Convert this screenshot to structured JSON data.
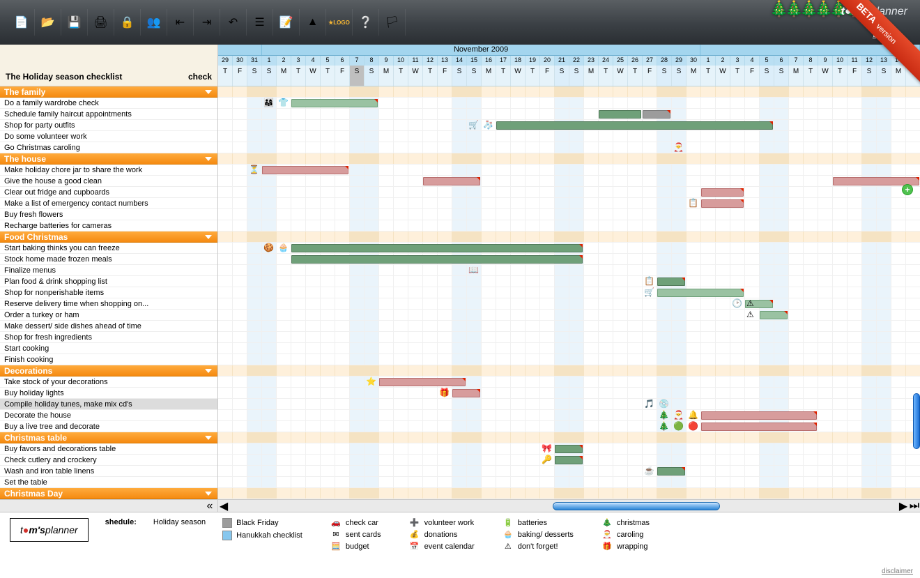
{
  "brand": "tom'splanner",
  "ribbon": {
    "main": "BETA",
    "sub": "version"
  },
  "logout": "Log out",
  "toolbar_icons": [
    {
      "name": "new-icon",
      "glyph": "📄"
    },
    {
      "name": "open-icon",
      "glyph": "📂"
    },
    {
      "name": "save-icon",
      "glyph": "💾"
    },
    {
      "name": "print-icon",
      "glyph": "🖨"
    },
    {
      "name": "lock-icon",
      "glyph": "🔒"
    },
    {
      "name": "share-icon",
      "glyph": "👥"
    },
    {
      "name": "import-icon",
      "glyph": "⇤"
    },
    {
      "name": "export-icon",
      "glyph": "⇥"
    },
    {
      "name": "undo-icon",
      "glyph": "↶"
    },
    {
      "name": "list-icon",
      "glyph": "☰"
    },
    {
      "name": "edit-icon",
      "glyph": "📝"
    },
    {
      "name": "milestone-icon",
      "glyph": "▲"
    },
    {
      "name": "logo-icon",
      "glyph": "★LOGO"
    },
    {
      "name": "help-icon",
      "glyph": "❔"
    },
    {
      "name": "flag-icon",
      "glyph": "🏳"
    }
  ],
  "left_header": {
    "title": "The Holiday season checklist",
    "col2": "check"
  },
  "timeline": {
    "month_title": "November 2009",
    "start_daynum": 29,
    "days": [
      {
        "n": 29,
        "w": "T",
        "we": false
      },
      {
        "n": 30,
        "w": "F",
        "we": false
      },
      {
        "n": 31,
        "w": "S",
        "we": true
      },
      {
        "n": 1,
        "w": "S",
        "we": true
      },
      {
        "n": 2,
        "w": "M",
        "we": false
      },
      {
        "n": 3,
        "w": "T",
        "we": false
      },
      {
        "n": 4,
        "w": "W",
        "we": false
      },
      {
        "n": 5,
        "w": "T",
        "we": false
      },
      {
        "n": 6,
        "w": "F",
        "we": false
      },
      {
        "n": 7,
        "w": "S",
        "we": true,
        "today": true
      },
      {
        "n": 8,
        "w": "S",
        "we": true
      },
      {
        "n": 9,
        "w": "M",
        "we": false
      },
      {
        "n": 10,
        "w": "T",
        "we": false
      },
      {
        "n": 11,
        "w": "W",
        "we": false
      },
      {
        "n": 12,
        "w": "T",
        "we": false
      },
      {
        "n": 13,
        "w": "F",
        "we": false
      },
      {
        "n": 14,
        "w": "S",
        "we": true
      },
      {
        "n": 15,
        "w": "S",
        "we": true
      },
      {
        "n": 16,
        "w": "M",
        "we": false
      },
      {
        "n": 17,
        "w": "T",
        "we": false
      },
      {
        "n": 18,
        "w": "W",
        "we": false
      },
      {
        "n": 19,
        "w": "T",
        "we": false
      },
      {
        "n": 20,
        "w": "F",
        "we": false
      },
      {
        "n": 21,
        "w": "S",
        "we": true
      },
      {
        "n": 22,
        "w": "S",
        "we": true
      },
      {
        "n": 23,
        "w": "M",
        "we": false
      },
      {
        "n": 24,
        "w": "T",
        "we": false
      },
      {
        "n": 25,
        "w": "W",
        "we": false
      },
      {
        "n": 26,
        "w": "T",
        "we": false
      },
      {
        "n": 27,
        "w": "F",
        "we": false
      },
      {
        "n": 28,
        "w": "S",
        "we": true
      },
      {
        "n": 29,
        "w": "S",
        "we": true
      },
      {
        "n": 30,
        "w": "M",
        "we": false
      },
      {
        "n": 1,
        "w": "T",
        "we": false
      },
      {
        "n": 2,
        "w": "W",
        "we": false
      },
      {
        "n": 3,
        "w": "T",
        "we": false
      },
      {
        "n": 4,
        "w": "F",
        "we": false
      },
      {
        "n": 5,
        "w": "S",
        "we": true
      },
      {
        "n": 6,
        "w": "S",
        "we": true
      },
      {
        "n": 7,
        "w": "M",
        "we": false
      },
      {
        "n": 8,
        "w": "T",
        "we": false
      },
      {
        "n": 9,
        "w": "W",
        "we": false
      },
      {
        "n": 10,
        "w": "T",
        "we": false
      },
      {
        "n": 11,
        "w": "F",
        "we": false
      },
      {
        "n": 12,
        "w": "S",
        "we": true
      },
      {
        "n": 13,
        "w": "S",
        "we": true
      },
      {
        "n": 14,
        "w": "M",
        "we": false
      },
      {
        "n": 15,
        "w": "T",
        "we": false
      }
    ]
  },
  "groups": [
    {
      "title": "The family",
      "rows": [
        {
          "t": "Do a family wardrobe check",
          "bars": [
            {
              "c": "green",
              "s": 5,
              "e": 10,
              "flag": true
            }
          ],
          "icons": [
            {
              "g": "👨‍👩‍👧",
              "at": 3
            },
            {
              "g": "👕",
              "at": 4
            }
          ]
        },
        {
          "t": "Schedule family haircut appointments",
          "bars": [
            {
              "c": "darkgreen",
              "s": 26,
              "e": 28
            },
            {
              "c": "grey",
              "s": 29,
              "e": 30,
              "flag": true
            }
          ]
        },
        {
          "t": "Shop for party outfits",
          "bars": [
            {
              "c": "darkgreen",
              "s": 19,
              "e": 37,
              "flag": true
            }
          ],
          "icons": [
            {
              "g": "🛒",
              "at": 17
            },
            {
              "g": "🧦",
              "at": 18
            }
          ]
        },
        {
          "t": "Do some volunteer work"
        },
        {
          "t": "Go Christmas caroling",
          "icons": [
            {
              "g": "🎅",
              "at": 31
            }
          ]
        }
      ]
    },
    {
      "title": "The house",
      "rows": [
        {
          "t": "Make holiday chore jar to share the work",
          "bars": [
            {
              "c": "red",
              "s": 3,
              "e": 8,
              "flag": true
            }
          ],
          "icons": [
            {
              "g": "⏳",
              "at": 2
            }
          ]
        },
        {
          "t": "Give the house a good clean",
          "bars": [
            {
              "c": "red",
              "s": 14,
              "e": 17,
              "flag": true
            },
            {
              "c": "red",
              "s": 42,
              "e": 47,
              "flag": true
            }
          ]
        },
        {
          "t": "Clear out fridge and cupboards",
          "bars": [
            {
              "c": "red",
              "s": 33,
              "e": 35,
              "flag": true
            }
          ]
        },
        {
          "t": "Make a list of emergency contact numbers",
          "bars": [
            {
              "c": "red",
              "s": 33,
              "e": 35,
              "flag": true
            }
          ],
          "icons": [
            {
              "g": "📋",
              "at": 32
            }
          ]
        },
        {
          "t": "Buy fresh flowers"
        },
        {
          "t": "Recharge batteries for cameras"
        }
      ]
    },
    {
      "title": "Food Christmas",
      "rows": [
        {
          "t": "Start baking thinks you can freeze",
          "bars": [
            {
              "c": "darkgreen",
              "s": 5,
              "e": 24,
              "flag": true
            }
          ],
          "icons": [
            {
              "g": "🍪",
              "at": 3
            },
            {
              "g": "🧁",
              "at": 4
            }
          ]
        },
        {
          "t": "Stock home made frozen meals",
          "bars": [
            {
              "c": "darkgreen",
              "s": 5,
              "e": 24,
              "flag": true
            }
          ]
        },
        {
          "t": "Finalize menus",
          "icons": [
            {
              "g": "📖",
              "at": 17
            }
          ]
        },
        {
          "t": "Plan food & drink shopping list",
          "bars": [
            {
              "c": "darkgreen",
              "s": 30,
              "e": 31,
              "flag": true
            }
          ],
          "icons": [
            {
              "g": "📋",
              "at": 29
            }
          ]
        },
        {
          "t": "Shop for nonperishable items",
          "bars": [
            {
              "c": "green",
              "s": 30,
              "e": 35,
              "flag": true
            }
          ],
          "icons": [
            {
              "g": "🛒",
              "at": 29
            }
          ]
        },
        {
          "t": "Reserve delivery time when shopping on...",
          "bars": [
            {
              "c": "green",
              "s": 36,
              "e": 37,
              "flag": true
            }
          ],
          "icons": [
            {
              "g": "🕑",
              "at": 35
            },
            {
              "g": "⚠",
              "at": 36
            }
          ]
        },
        {
          "t": "Order a turkey or ham",
          "bars": [
            {
              "c": "green",
              "s": 37,
              "e": 38,
              "flag": true
            }
          ],
          "icons": [
            {
              "g": "⚠",
              "at": 36
            }
          ]
        },
        {
          "t": "Make dessert/ side dishes ahead of time"
        },
        {
          "t": "Shop for fresh ingredients"
        },
        {
          "t": "Start cooking"
        },
        {
          "t": "Finish cooking"
        }
      ]
    },
    {
      "title": "Decorations",
      "rows": [
        {
          "t": "Take stock of your decorations",
          "bars": [
            {
              "c": "red",
              "s": 11,
              "e": 16,
              "flag": true
            }
          ],
          "icons": [
            {
              "g": "⭐",
              "at": 10
            }
          ]
        },
        {
          "t": "Buy holiday lights",
          "bars": [
            {
              "c": "red",
              "s": 16,
              "e": 17,
              "flag": true
            }
          ],
          "icons": [
            {
              "g": "🎁",
              "at": 15
            }
          ]
        },
        {
          "t": "Compile holiday tunes, make mix cd's",
          "sel": true,
          "icons": [
            {
              "g": "🎵",
              "at": 29
            },
            {
              "g": "💿",
              "at": 30
            }
          ]
        },
        {
          "t": "Decorate the house",
          "bars": [
            {
              "c": "red",
              "s": 33,
              "e": 40,
              "flag": true
            }
          ],
          "icons": [
            {
              "g": "🎄",
              "at": 30
            },
            {
              "g": "🎅",
              "at": 31
            },
            {
              "g": "🔔",
              "at": 32
            }
          ]
        },
        {
          "t": "Buy a live tree and decorate",
          "bars": [
            {
              "c": "red",
              "s": 33,
              "e": 40,
              "flag": true
            }
          ],
          "icons": [
            {
              "g": "🎄",
              "at": 30
            },
            {
              "g": "🟢",
              "at": 31
            },
            {
              "g": "🔴",
              "at": 32
            }
          ]
        }
      ]
    },
    {
      "title": "Christmas table",
      "rows": [
        {
          "t": "Buy favors and decorations table",
          "bars": [
            {
              "c": "darkgreen",
              "s": 23,
              "e": 24,
              "flag": true
            }
          ],
          "icons": [
            {
              "g": "🎀",
              "at": 22
            }
          ]
        },
        {
          "t": "Check cutlery and crockery",
          "bars": [
            {
              "c": "darkgreen",
              "s": 23,
              "e": 24,
              "flag": true
            }
          ],
          "icons": [
            {
              "g": "🔑",
              "at": 22
            }
          ]
        },
        {
          "t": "Wash and iron table linens",
          "bars": [
            {
              "c": "darkgreen",
              "s": 30,
              "e": 31,
              "flag": true
            }
          ],
          "icons": [
            {
              "g": "☕",
              "at": 29
            }
          ]
        },
        {
          "t": "Set the table"
        }
      ]
    },
    {
      "title": "Christmas Day",
      "rows": []
    }
  ],
  "footer": {
    "schedule_label": "shedule:",
    "schedule_value": "Holiday season",
    "legend_columns": [
      [
        {
          "color": "#9c9c9c",
          "text": "Black Friday"
        },
        {
          "color": "#87c7ee",
          "text": "Hanukkah checklist"
        }
      ],
      [
        {
          "glyph": "🚗",
          "text": "check car"
        },
        {
          "glyph": "✉",
          "text": "sent cards"
        },
        {
          "glyph": "🧮",
          "text": "budget"
        }
      ],
      [
        {
          "glyph": "➕",
          "text": "volunteer work"
        },
        {
          "glyph": "💰",
          "text": "donations"
        },
        {
          "glyph": "📅",
          "text": "event calendar"
        }
      ],
      [
        {
          "glyph": "🔋",
          "text": "batteries"
        },
        {
          "glyph": "🧁",
          "text": "baking/ desserts"
        },
        {
          "glyph": "⚠",
          "text": "don't forget!"
        }
      ],
      [
        {
          "glyph": "🎄",
          "text": "christmas"
        },
        {
          "glyph": "🎅",
          "text": "caroling"
        },
        {
          "glyph": "🎁",
          "text": "wrapping"
        }
      ]
    ],
    "disclaimer": "disclaimer"
  }
}
